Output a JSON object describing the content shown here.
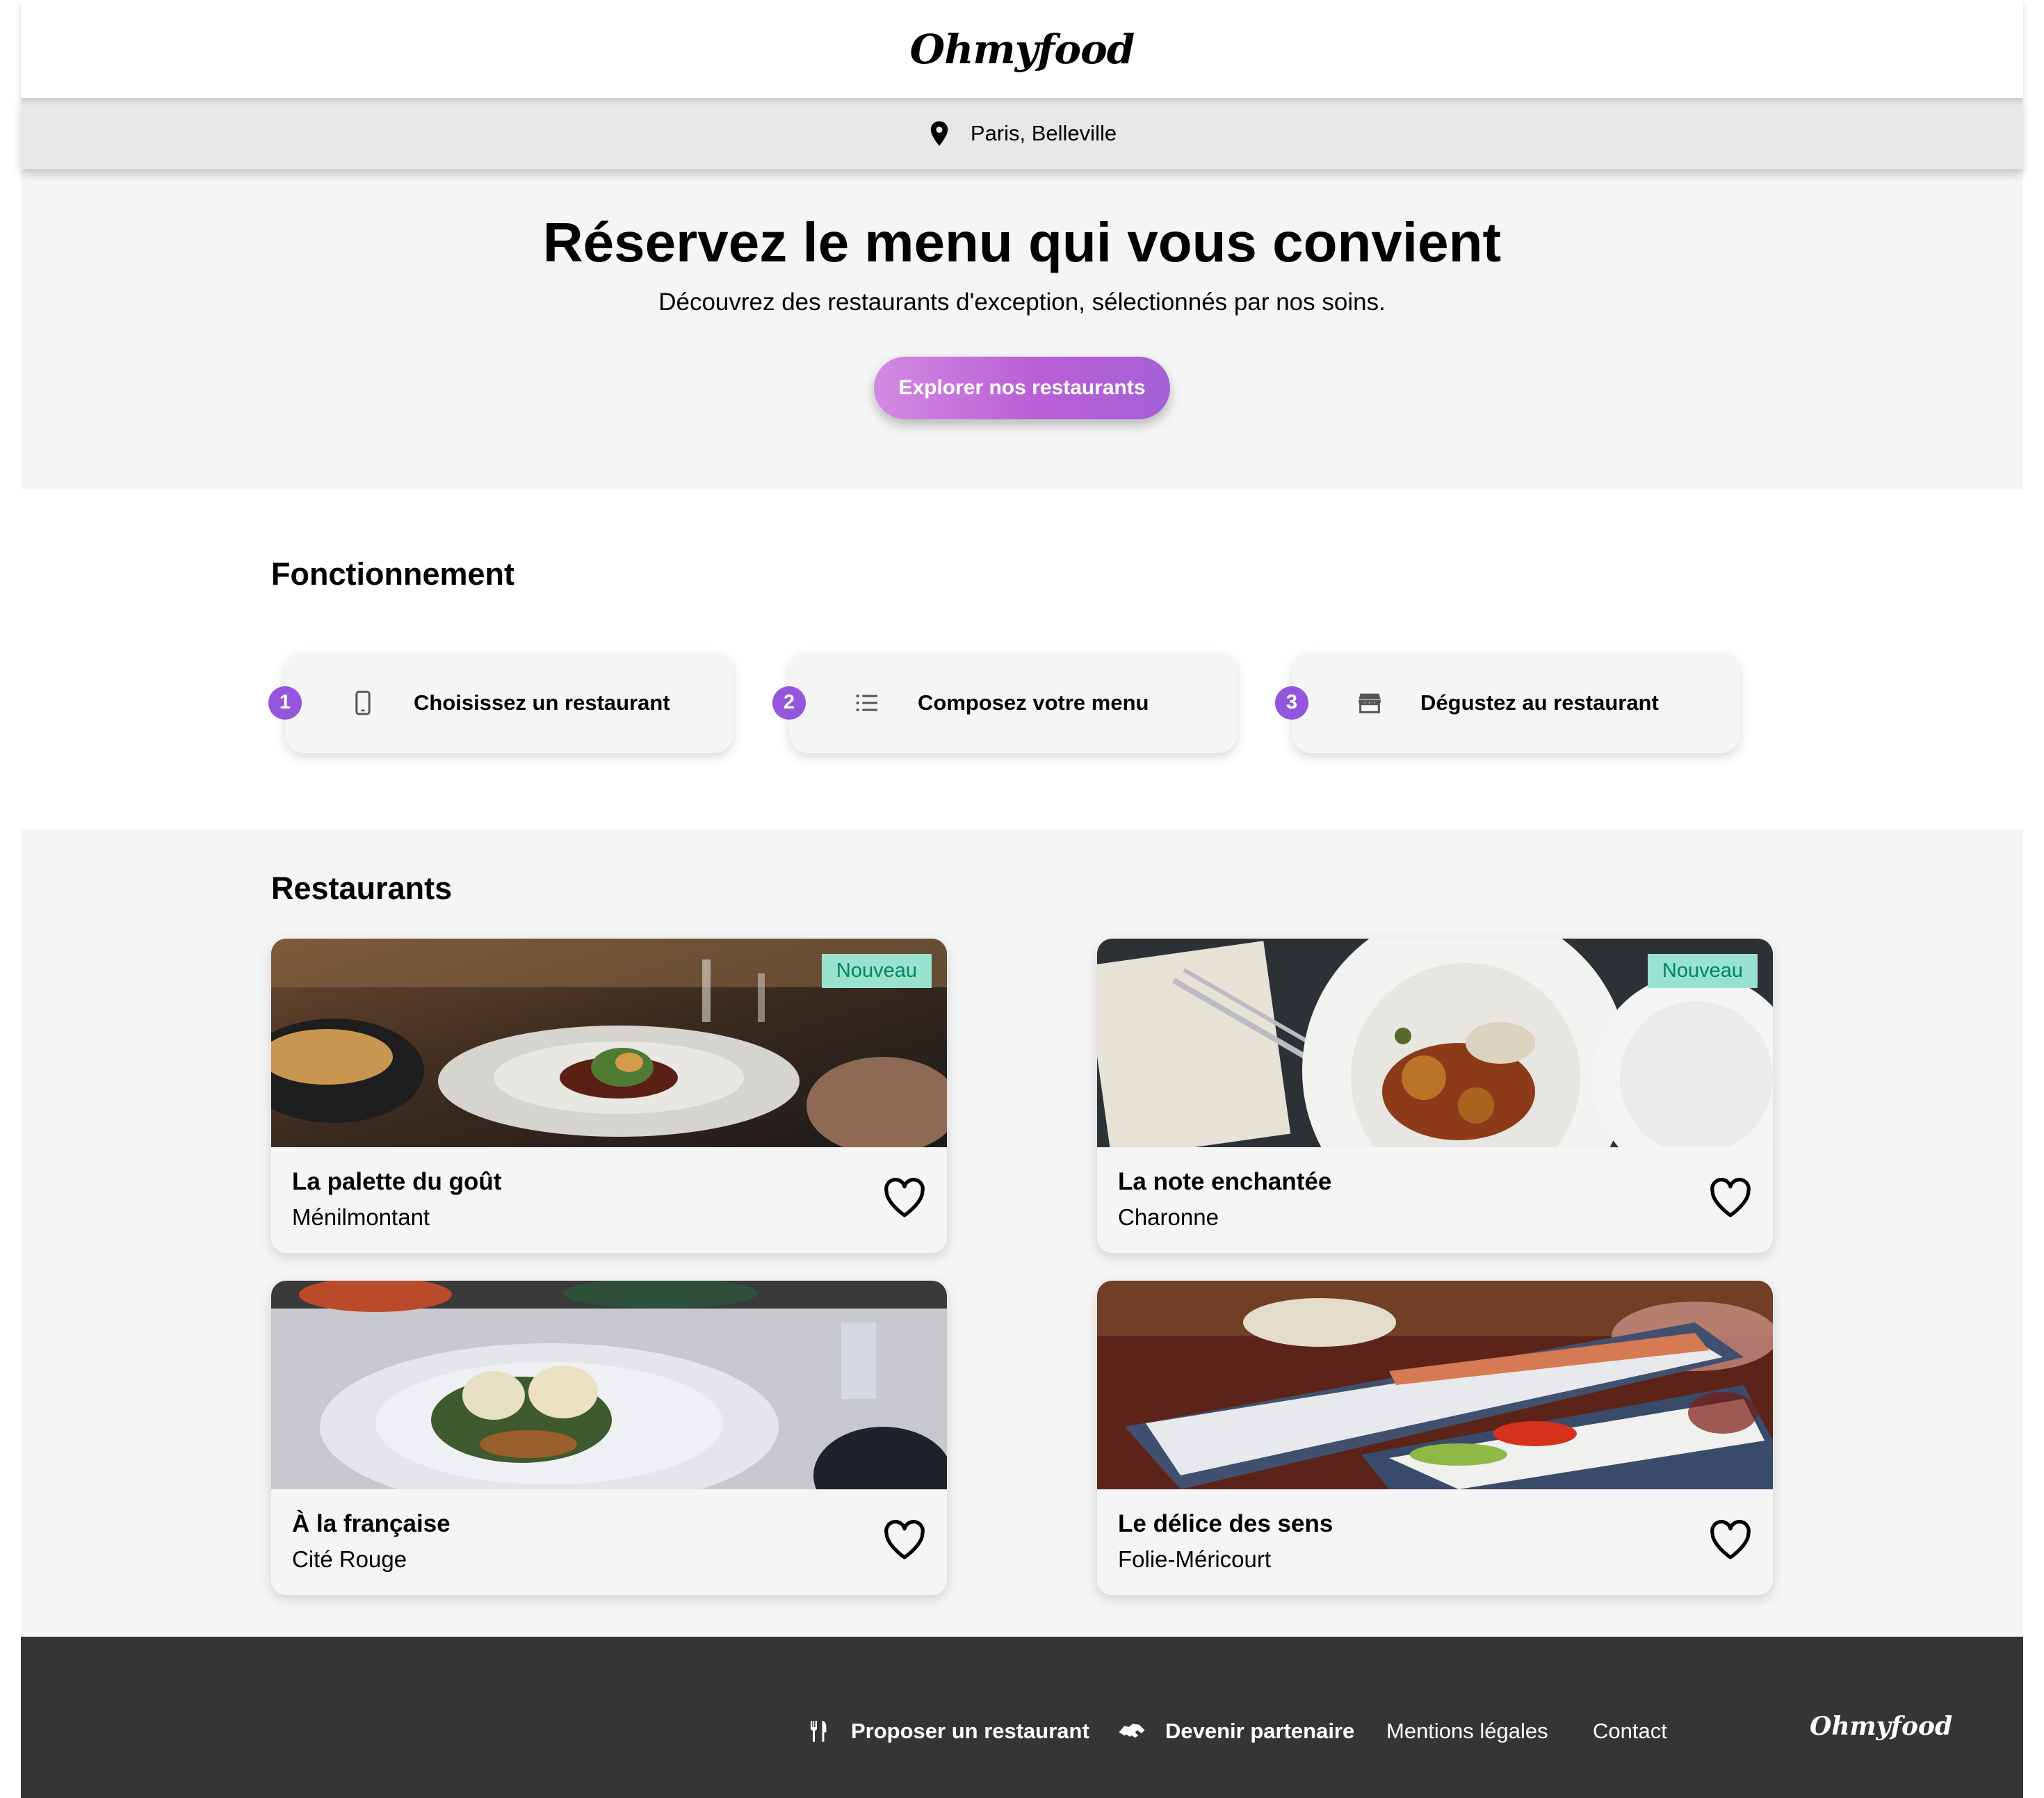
{
  "header": {
    "logo": "Ohmyfood"
  },
  "location": {
    "icon": "map-pin-icon",
    "text": "Paris, Belleville"
  },
  "hero": {
    "title": "Réservez le menu qui vous convient",
    "subtitle": "Découvrez des restaurants d'exception, sélectionnés par nos soins.",
    "cta_label": "Explorer nos restaurants"
  },
  "how_it_works": {
    "title": "Fonctionnement",
    "steps": [
      {
        "number": "1",
        "icon": "mobile-phone-icon",
        "label": "Choisissez un restaurant"
      },
      {
        "number": "2",
        "icon": "list-icon",
        "label": "Composez votre menu"
      },
      {
        "number": "3",
        "icon": "storefront-icon",
        "label": "Dégustez au restaurant"
      }
    ]
  },
  "restaurants": {
    "title": "Restaurants",
    "items": [
      {
        "name": "La palette du goût",
        "area": "Ménilmontant",
        "badge": "Nouveau"
      },
      {
        "name": "La note enchantée",
        "area": "Charonne",
        "badge": "Nouveau"
      },
      {
        "name": "À la française",
        "area": "Cité Rouge",
        "badge": ""
      },
      {
        "name": "Le délice des sens",
        "area": "Folie-Méricourt",
        "badge": ""
      }
    ]
  },
  "footer": {
    "links": [
      {
        "icon": "utensils-icon",
        "label": "Proposer un restaurant"
      },
      {
        "icon": "handshake-icon",
        "label": "Devenir partenaire"
      },
      {
        "label": "Mentions légales"
      },
      {
        "label": "Contact"
      }
    ],
    "logo": "Ohmyfood"
  },
  "colors": {
    "accent": "#9356dc",
    "badge_bg": "#99e2d0",
    "badge_text": "#00855f",
    "footer_bg": "#353535"
  }
}
